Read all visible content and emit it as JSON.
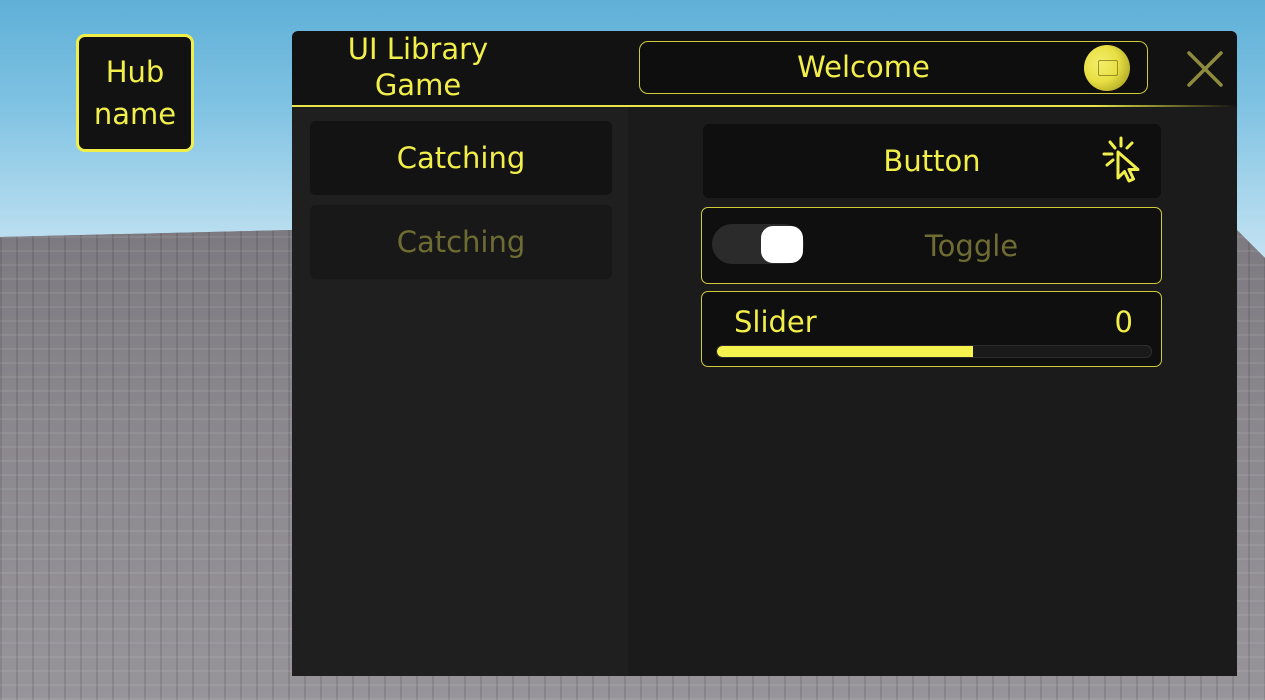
{
  "hub_button": {
    "label": "Hub\nname"
  },
  "window": {
    "title": "UI Library\nGame",
    "welcome_text": "Welcome",
    "tabs": [
      {
        "label": "Catching",
        "active": true
      },
      {
        "label": "Catching",
        "active": false
      }
    ],
    "controls": {
      "button_label": "Button",
      "button_icon": "click-cursor-icon",
      "toggle_label": "Toggle",
      "toggle_state": true,
      "slider_label": "Slider",
      "slider_value": "0",
      "slider_fill_fraction": 0.59
    }
  },
  "colors": {
    "accent": "#f2ef4a",
    "dim_text": "#6f6c33",
    "panel": "#121212",
    "sidebar": "#1f1f1f"
  }
}
